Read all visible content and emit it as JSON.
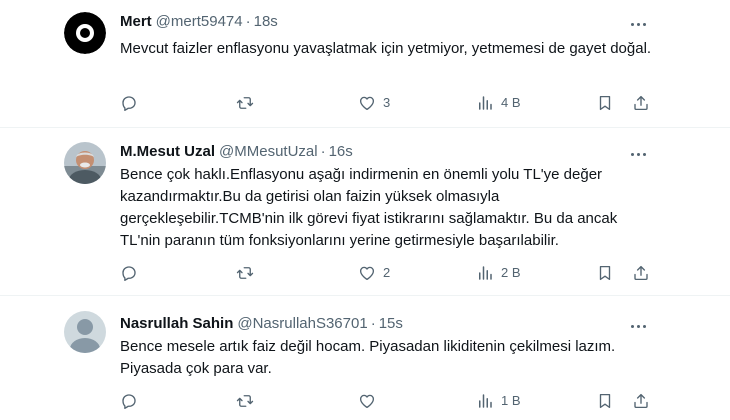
{
  "tweets": [
    {
      "name": "Mert",
      "handle": "@mert59474",
      "separator": "·",
      "time": "18s",
      "text": "Mevcut faizler enflasyonu yavaşlatmak için yetmiyor, yetmemesi de gayet doğal.",
      "replies": "",
      "retweets": "",
      "likes": "3",
      "views": "4 B"
    },
    {
      "name": "M.Mesut Uzal",
      "handle": "@MMesutUzal",
      "separator": "·",
      "time": "16s",
      "text": "Bence çok haklı.Enflasyonu aşağı indirmenin en önemli yolu TL'ye değer kazandırmaktır.Bu da getirisi olan faizin yüksek olmasıyla gerçekleşebilir.TCMB'nin ilk görevi fiyat istikrarını sağlamaktır. Bu da ancak TL'nin paranın tüm fonksiyonlarını yerine getirmesiyle başarılabilir.",
      "replies": "",
      "retweets": "",
      "likes": "2",
      "views": "2 B"
    },
    {
      "name": "Nasrullah Sahin",
      "handle": "@NasrullahS36701",
      "separator": "·",
      "time": "15s",
      "text": "Bence mesele artık faiz değil hocam. Piyasadan likiditenin çekilmesi lazım. Piyasada çok para var.",
      "replies": "",
      "retweets": "",
      "likes": "",
      "views": "1 B"
    }
  ],
  "colors": {
    "text_primary": "#0f1419",
    "text_secondary": "#536471",
    "divider": "#eff3f4"
  }
}
